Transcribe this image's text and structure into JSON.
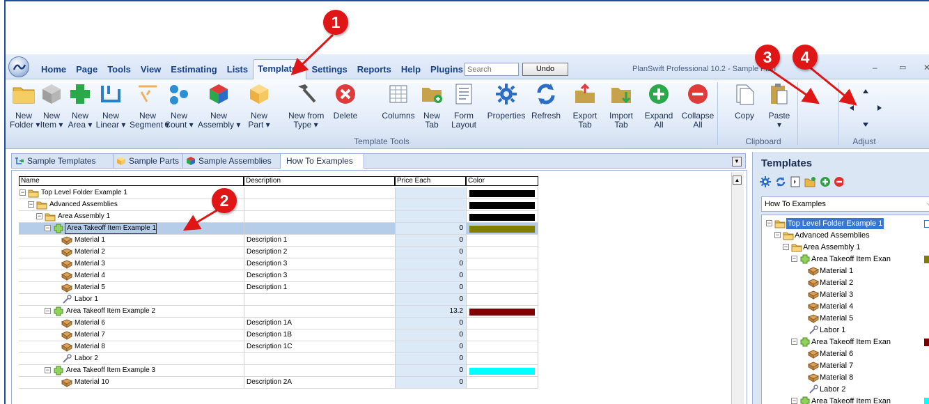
{
  "app": {
    "window_title": "PlanSwift Professional 10.2 - Sample Plan",
    "search_placeholder": "Search",
    "undo_label": "Undo"
  },
  "menu_tabs": [
    "Home",
    "Page",
    "Tools",
    "View",
    "Estimating",
    "Lists",
    "Templates",
    "Settings",
    "Reports",
    "Help",
    "Plugins"
  ],
  "active_menu_tab": "Templates",
  "ribbon": {
    "buttons": [
      {
        "id": "new-folder",
        "line1": "New",
        "line2": "Folder ▾",
        "icon": "folder-icon"
      },
      {
        "id": "new-item",
        "line1": "New",
        "line2": "Item ▾",
        "icon": "cube-gray-icon"
      },
      {
        "id": "new-area",
        "line1": "New",
        "line2": "Area ▾",
        "icon": "area-icon"
      },
      {
        "id": "new-linear",
        "line1": "New",
        "line2": "Linear ▾",
        "icon": "linear-icon"
      },
      {
        "id": "new-segment",
        "line1": "New",
        "line2": "Segment ▾",
        "icon": "segment-icon"
      },
      {
        "id": "new-count",
        "line1": "New",
        "line2": "Count ▾",
        "icon": "count-icon"
      },
      {
        "id": "new-assembly",
        "line1": "New",
        "line2": "Assembly ▾",
        "icon": "assembly-cube-icon"
      },
      {
        "id": "new-part",
        "line1": "New",
        "line2": "Part ▾",
        "icon": "part-cube-icon"
      },
      {
        "id": "new-from-type",
        "line1": "New from",
        "line2": "Type ▾",
        "icon": "hammer-icon"
      },
      {
        "id": "delete",
        "line1": "Delete",
        "line2": "",
        "icon": "delete-x-icon"
      },
      {
        "id": "columns",
        "line1": "Columns",
        "line2": "",
        "icon": "columns-icon"
      },
      {
        "id": "new-tab",
        "line1": "New",
        "line2": "Tab",
        "icon": "new-tab-folder-icon"
      },
      {
        "id": "form-layout",
        "line1": "Form",
        "line2": "Layout",
        "icon": "form-layout-icon"
      },
      {
        "id": "properties",
        "line1": "Properties",
        "line2": "",
        "icon": "gear-icon"
      },
      {
        "id": "refresh",
        "line1": "Refresh",
        "line2": "",
        "icon": "refresh-icon"
      },
      {
        "id": "export-tab",
        "line1": "Export",
        "line2": "Tab",
        "icon": "export-tab-icon"
      },
      {
        "id": "import-tab",
        "line1": "Import",
        "line2": "Tab",
        "icon": "import-tab-icon"
      },
      {
        "id": "expand-all",
        "line1": "Expand",
        "line2": "All",
        "icon": "plus-circle-icon"
      },
      {
        "id": "collapse-all",
        "line1": "Collapse",
        "line2": "All",
        "icon": "minus-circle-icon"
      },
      {
        "id": "copy",
        "line1": "Copy",
        "line2": "",
        "icon": "copy-icon"
      },
      {
        "id": "paste",
        "line1": "Paste",
        "line2": "▾",
        "icon": "paste-icon"
      }
    ],
    "groups": {
      "template_tools": "Template Tools",
      "clipboard": "Clipboard",
      "adjust": "Adjust"
    }
  },
  "doc_tabs": [
    {
      "label": "Sample Templates",
      "icon": "templates-icon"
    },
    {
      "label": "Sample Parts",
      "icon": "part-cube-icon"
    },
    {
      "label": "Sample Assemblies",
      "icon": "assembly-cube-icon"
    },
    {
      "label": "How To Examples",
      "icon": ""
    }
  ],
  "grid": {
    "columns": [
      "Name",
      "Description",
      "Price Each",
      "Color"
    ],
    "rows": [
      {
        "name": "Top Level Folder Example 1",
        "desc": "",
        "price": "",
        "color": "#000000",
        "type": "folder",
        "level": 0
      },
      {
        "name": "Advanced Assemblies",
        "desc": "",
        "price": "",
        "color": "#000000",
        "type": "folder",
        "level": 1
      },
      {
        "name": "Area Assembly 1",
        "desc": "",
        "price": "",
        "color": "#000000",
        "type": "folder",
        "level": 2
      },
      {
        "name": "Area Takeoff Item Example 1",
        "desc": "",
        "price": "0",
        "color": "#808000",
        "type": "area",
        "level": 3,
        "selected": true
      },
      {
        "name": "Material 1",
        "desc": "Description 1",
        "price": "0",
        "color": "",
        "type": "material",
        "level": 4
      },
      {
        "name": "Material 2",
        "desc": "Description 2",
        "price": "0",
        "color": "",
        "type": "material",
        "level": 4
      },
      {
        "name": "Material 3",
        "desc": "Description 3",
        "price": "0",
        "color": "",
        "type": "material",
        "level": 4
      },
      {
        "name": "Material 4",
        "desc": "Description 3",
        "price": "0",
        "color": "",
        "type": "material",
        "level": 4
      },
      {
        "name": "Material 5",
        "desc": "Description 1",
        "price": "0",
        "color": "",
        "type": "material",
        "level": 4
      },
      {
        "name": "Labor 1",
        "desc": "",
        "price": "0",
        "color": "",
        "type": "labor",
        "level": 4
      },
      {
        "name": "Area Takeoff Item Example 2",
        "desc": "",
        "price": "13.2",
        "color": "#800000",
        "type": "area",
        "level": 3
      },
      {
        "name": "Material 6",
        "desc": "Description 1A",
        "price": "0",
        "color": "",
        "type": "material",
        "level": 4
      },
      {
        "name": "Material 7",
        "desc": "Description 1B",
        "price": "0",
        "color": "",
        "type": "material",
        "level": 4
      },
      {
        "name": "Material 8",
        "desc": "Description 1C",
        "price": "0",
        "color": "",
        "type": "material",
        "level": 4
      },
      {
        "name": "Labor 2",
        "desc": "",
        "price": "0",
        "color": "",
        "type": "labor",
        "level": 4
      },
      {
        "name": "Area Takeoff Item Example 3",
        "desc": "",
        "price": "0",
        "color": "#00ffff",
        "type": "area",
        "level": 3
      },
      {
        "name": "Material 10",
        "desc": "Description 2A",
        "price": "0",
        "color": "",
        "type": "material",
        "level": 4
      }
    ]
  },
  "templates_panel": {
    "title": "Templates",
    "selected_template": "How To Examples",
    "tree": [
      {
        "name": "Top Level Folder Example 1",
        "type": "folder",
        "level": 0,
        "selected": true,
        "color": ""
      },
      {
        "name": "Advanced Assemblies",
        "type": "folder",
        "level": 1,
        "color": ""
      },
      {
        "name": "Area Assembly 1",
        "type": "folder",
        "level": 2,
        "color": ""
      },
      {
        "name": "Area Takeoff Item Exan",
        "type": "area",
        "level": 3,
        "color": "#808000"
      },
      {
        "name": "Material 1",
        "type": "material",
        "level": 4,
        "color": ""
      },
      {
        "name": "Material 2",
        "type": "material",
        "level": 4,
        "color": ""
      },
      {
        "name": "Material 3",
        "type": "material",
        "level": 4,
        "color": ""
      },
      {
        "name": "Material 4",
        "type": "material",
        "level": 4,
        "color": ""
      },
      {
        "name": "Material 5",
        "type": "material",
        "level": 4,
        "color": ""
      },
      {
        "name": "Labor 1",
        "type": "labor",
        "level": 4,
        "color": ""
      },
      {
        "name": "Area Takeoff Item Exan",
        "type": "area",
        "level": 3,
        "color": "#800000"
      },
      {
        "name": "Material 6",
        "type": "material",
        "level": 4,
        "color": ""
      },
      {
        "name": "Material 7",
        "type": "material",
        "level": 4,
        "color": ""
      },
      {
        "name": "Material 8",
        "type": "material",
        "level": 4,
        "color": ""
      },
      {
        "name": "Labor 2",
        "type": "labor",
        "level": 4,
        "color": ""
      },
      {
        "name": "Area Takeoff Item Exan",
        "type": "area",
        "level": 3,
        "color": "#00ffff"
      }
    ]
  },
  "callouts": [
    "1",
    "2",
    "3",
    "4"
  ],
  "colors": {
    "callout": "#e01515",
    "price_column": "#dce9f7",
    "ribbon_text": "#15428b"
  }
}
